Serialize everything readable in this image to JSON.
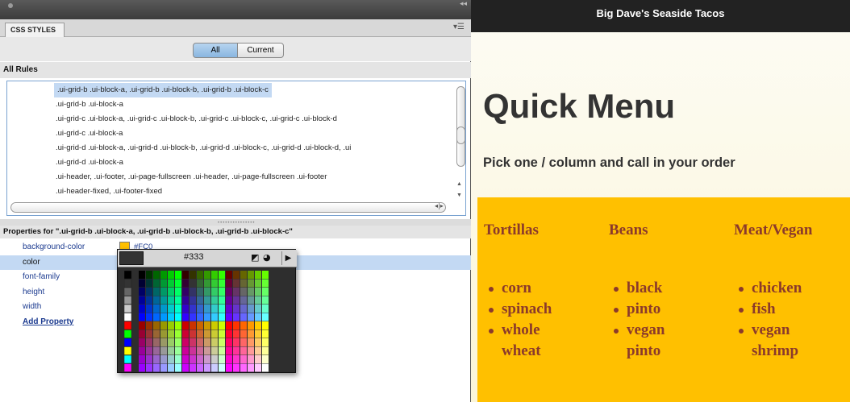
{
  "panel": {
    "tab_label": "CSS STYLES",
    "seg_all": "All",
    "seg_current": "Current",
    "all_rules_label": "All Rules",
    "rules": [
      ".ui-grid-b .ui-block-a, .ui-grid-b .ui-block-b, .ui-grid-b .ui-block-c",
      ".ui-grid-b .ui-block-a",
      ".ui-grid-c .ui-block-a, .ui-grid-c .ui-block-b, .ui-grid-c .ui-block-c, .ui-grid-c .ui-block-d",
      ".ui-grid-c .ui-block-a",
      ".ui-grid-d .ui-block-a, .ui-grid-d .ui-block-b, .ui-grid-d .ui-block-c, .ui-grid-d .ui-block-d, .ui",
      ".ui-grid-d .ui-block-a",
      ".ui-header, .ui-footer, .ui-page-fullscreen .ui-header, .ui-page-fullscreen .ui-footer",
      ".ui-header-fixed, .ui-footer-fixed"
    ],
    "properties_header": "Properties for \".ui-grid-b .ui-block-a, .ui-grid-b .ui-block-b, .ui-grid-b .ui-block-c\"",
    "properties": [
      {
        "name": "background-color",
        "value": "#FC0"
      },
      {
        "name": "color",
        "value": ""
      },
      {
        "name": "font-family",
        "value": ""
      },
      {
        "name": "height",
        "value": ""
      },
      {
        "name": "width",
        "value": ""
      }
    ],
    "add_property": "Add Property",
    "picker": {
      "hex": "#333",
      "current_color": "#333333",
      "swatch_color": "#FFC000"
    }
  },
  "preview": {
    "title_bar": "Big Dave's Seaside Tacos",
    "heading": "Quick Menu",
    "subheading": "Pick one / column and call in your order",
    "columns": [
      {
        "title": "Tortillas",
        "items": [
          "corn",
          "spinach",
          "whole wheat"
        ]
      },
      {
        "title": "Beans",
        "items": [
          "black",
          "pinto",
          "vegan pinto"
        ]
      },
      {
        "title": "Meat/Vegan",
        "items": [
          "chicken",
          "fish",
          "vegan shrimp"
        ]
      }
    ],
    "accent_color": "#FFC000",
    "text_color": "#8b3a2b"
  }
}
